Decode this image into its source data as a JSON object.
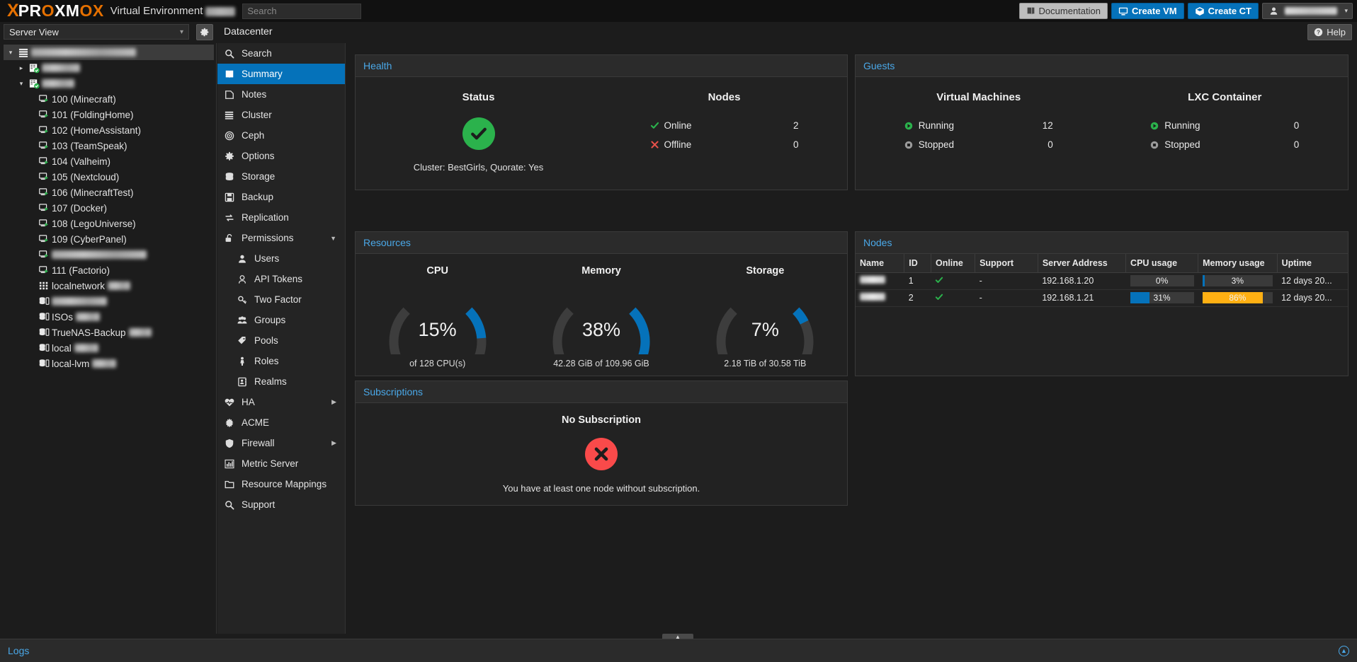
{
  "header": {
    "brand_x": "X",
    "brand_name_part1": "PR",
    "brand_name_o": "O",
    "brand_name_part2": "XM",
    "brand_name_o2": "O",
    "brand_name_part3": "X",
    "product": "Virtual Environment",
    "search_placeholder": "Search",
    "documentation_label": "Documentation",
    "create_vm_label": "Create VM",
    "create_ct_label": "Create CT",
    "help_label": "Help"
  },
  "toolbar": {
    "view_selector_value": "Server View",
    "breadcrumb": "Datacenter"
  },
  "tree": {
    "items": [
      {
        "label": "",
        "blurred": true,
        "blur_width": 148,
        "level": 0,
        "icon": "datacenter-icon",
        "expander": "down",
        "selected": true
      },
      {
        "label": "",
        "blurred": true,
        "blur_width": 54,
        "level": 1,
        "icon": "node-icon",
        "expander": "right",
        "selected": false
      },
      {
        "label": "",
        "blurred": true,
        "blur_width": 46,
        "level": 1,
        "icon": "node-icon",
        "expander": "down",
        "selected": false
      },
      {
        "label": "100 (Minecraft)",
        "blurred": false,
        "level": 2,
        "icon": "vm-icon",
        "selected": false
      },
      {
        "label": "101 (FoldingHome)",
        "blurred": false,
        "level": 2,
        "icon": "vm-icon",
        "selected": false
      },
      {
        "label": "102 (HomeAssistant)",
        "blurred": false,
        "level": 2,
        "icon": "vm-icon",
        "selected": false
      },
      {
        "label": "103 (TeamSpeak)",
        "blurred": false,
        "level": 2,
        "icon": "vm-icon",
        "selected": false
      },
      {
        "label": "104 (Valheim)",
        "blurred": false,
        "level": 2,
        "icon": "vm-icon",
        "selected": false
      },
      {
        "label": "105 (Nextcloud)",
        "blurred": false,
        "level": 2,
        "icon": "vm-icon",
        "selected": false
      },
      {
        "label": "106 (MinecraftTest)",
        "blurred": false,
        "level": 2,
        "icon": "vm-icon",
        "selected": false
      },
      {
        "label": "107 (Docker)",
        "blurred": false,
        "level": 2,
        "icon": "vm-icon",
        "selected": false
      },
      {
        "label": "108 (LegoUniverse)",
        "blurred": false,
        "level": 2,
        "icon": "vm-icon",
        "selected": false
      },
      {
        "label": "109 (CyberPanel)",
        "blurred": false,
        "level": 2,
        "icon": "vm-icon",
        "selected": false
      },
      {
        "label": "",
        "blurred": true,
        "blur_width": 134,
        "level": 2,
        "icon": "vm-icon",
        "selected": false
      },
      {
        "label": "111 (Factorio)",
        "blurred": false,
        "level": 2,
        "icon": "vm-icon",
        "selected": false
      },
      {
        "label": "localnetwork",
        "blurred": false,
        "blur_suffix": 32,
        "level": 2,
        "icon": "sdn-icon",
        "selected": false
      },
      {
        "label": "",
        "blurred": true,
        "blur_width": 78,
        "level": 2,
        "icon": "storage-icon",
        "selected": false
      },
      {
        "label": "ISOs",
        "blurred": false,
        "blur_suffix": 34,
        "level": 2,
        "icon": "storage-icon",
        "selected": false
      },
      {
        "label": "TrueNAS-Backup",
        "blurred": false,
        "blur_suffix": 32,
        "level": 2,
        "icon": "storage-icon",
        "selected": false
      },
      {
        "label": "local",
        "blurred": false,
        "blur_suffix": 34,
        "level": 2,
        "icon": "storage-icon",
        "selected": false
      },
      {
        "label": "local-lvm",
        "blurred": false,
        "blur_suffix": 34,
        "level": 2,
        "icon": "storage-icon",
        "selected": false
      }
    ]
  },
  "nav": {
    "items": [
      {
        "label": "Search",
        "icon": "search-icon",
        "selected": false,
        "sub": false,
        "expander": ""
      },
      {
        "label": "Summary",
        "icon": "summary-icon",
        "selected": true,
        "sub": false,
        "expander": ""
      },
      {
        "label": "Notes",
        "icon": "notes-icon",
        "selected": false,
        "sub": false,
        "expander": ""
      },
      {
        "label": "Cluster",
        "icon": "cluster-icon",
        "selected": false,
        "sub": false,
        "expander": ""
      },
      {
        "label": "Ceph",
        "icon": "ceph-icon",
        "selected": false,
        "sub": false,
        "expander": ""
      },
      {
        "label": "Options",
        "icon": "gear-icon",
        "selected": false,
        "sub": false,
        "expander": ""
      },
      {
        "label": "Storage",
        "icon": "storage-icon",
        "selected": false,
        "sub": false,
        "expander": ""
      },
      {
        "label": "Backup",
        "icon": "backup-icon",
        "selected": false,
        "sub": false,
        "expander": ""
      },
      {
        "label": "Replication",
        "icon": "replication-icon",
        "selected": false,
        "sub": false,
        "expander": ""
      },
      {
        "label": "Permissions",
        "icon": "lock-icon",
        "selected": false,
        "sub": false,
        "expander": "down"
      },
      {
        "label": "Users",
        "icon": "user-icon",
        "selected": false,
        "sub": true,
        "expander": ""
      },
      {
        "label": "API Tokens",
        "icon": "token-icon",
        "selected": false,
        "sub": true,
        "expander": ""
      },
      {
        "label": "Two Factor",
        "icon": "key-icon",
        "selected": false,
        "sub": true,
        "expander": ""
      },
      {
        "label": "Groups",
        "icon": "groups-icon",
        "selected": false,
        "sub": true,
        "expander": ""
      },
      {
        "label": "Pools",
        "icon": "tag-icon",
        "selected": false,
        "sub": true,
        "expander": ""
      },
      {
        "label": "Roles",
        "icon": "person-icon",
        "selected": false,
        "sub": true,
        "expander": ""
      },
      {
        "label": "Realms",
        "icon": "realm-icon",
        "selected": false,
        "sub": true,
        "expander": ""
      },
      {
        "label": "HA",
        "icon": "heartbeat-icon",
        "selected": false,
        "sub": false,
        "expander": "right"
      },
      {
        "label": "ACME",
        "icon": "acme-icon",
        "selected": false,
        "sub": false,
        "expander": ""
      },
      {
        "label": "Firewall",
        "icon": "shield-icon",
        "selected": false,
        "sub": false,
        "expander": "right"
      },
      {
        "label": "Metric Server",
        "icon": "chart-icon",
        "selected": false,
        "sub": false,
        "expander": ""
      },
      {
        "label": "Resource Mappings",
        "icon": "folder-icon",
        "selected": false,
        "sub": false,
        "expander": ""
      },
      {
        "label": "Support",
        "icon": "support-icon",
        "selected": false,
        "sub": false,
        "expander": ""
      }
    ]
  },
  "health": {
    "panel_title": "Health",
    "status_heading": "Status",
    "nodes_heading": "Nodes",
    "cluster_line": "Cluster: BestGirls, Quorate: Yes",
    "status_color": "#2bb24c",
    "rows": [
      {
        "label": "Online",
        "value": "2",
        "icon": "check-icon",
        "color": "#2bb24c"
      },
      {
        "label": "Offline",
        "value": "0",
        "icon": "cross-icon",
        "color": "#e8514a"
      }
    ]
  },
  "guests": {
    "panel_title": "Guests",
    "vm_heading": "Virtual Machines",
    "lxc_heading": "LXC Container",
    "vm_rows": [
      {
        "label": "Running",
        "value": "12",
        "icon": "running-icon",
        "color": "#2bb24c"
      },
      {
        "label": "Stopped",
        "value": "0",
        "icon": "stopped-icon",
        "color": "#9a9a9a"
      }
    ],
    "lxc_rows": [
      {
        "label": "Running",
        "value": "0",
        "icon": "running-icon",
        "color": "#2bb24c"
      },
      {
        "label": "Stopped",
        "value": "0",
        "icon": "stopped-icon",
        "color": "#9a9a9a"
      }
    ]
  },
  "resources": {
    "panel_title": "Resources",
    "accent_color": "#0572ba",
    "gauges": [
      {
        "title": "CPU",
        "percent": 15,
        "value_text": "15%",
        "sub": "of 128 CPU(s)"
      },
      {
        "title": "Memory",
        "percent": 38,
        "value_text": "38%",
        "sub": "42.28 GiB of 109.96 GiB"
      },
      {
        "title": "Storage",
        "percent": 7,
        "value_text": "7%",
        "sub": "2.18 TiB of 30.58 TiB"
      }
    ]
  },
  "nodes": {
    "panel_title": "Nodes",
    "columns": [
      "Name",
      "ID",
      "Online",
      "Support",
      "Server Address",
      "CPU usage",
      "Memory usage",
      "Uptime"
    ],
    "rows": [
      {
        "name": "",
        "name_blurred": true,
        "id": "1",
        "online": "check-icon",
        "support": "-",
        "address": "192.168.1.20",
        "cpu_text": "0%",
        "cpu_percent": 0,
        "mem_text": "3%",
        "mem_percent": 3,
        "mem_color": "#0572ba",
        "uptime": "12 days 20..."
      },
      {
        "name": "",
        "name_blurred": true,
        "id": "2",
        "online": "check-icon",
        "support": "-",
        "address": "192.168.1.21",
        "cpu_text": "31%",
        "cpu_percent": 31,
        "mem_text": "86%",
        "mem_percent": 86,
        "mem_color": "#ffb013",
        "uptime": "12 days 20..."
      }
    ]
  },
  "subscriptions": {
    "panel_title": "Subscriptions",
    "heading": "No Subscription",
    "message": "You have at least one node without subscription.",
    "status_color": "#fa4a4a"
  },
  "logs": {
    "title": "Logs"
  }
}
